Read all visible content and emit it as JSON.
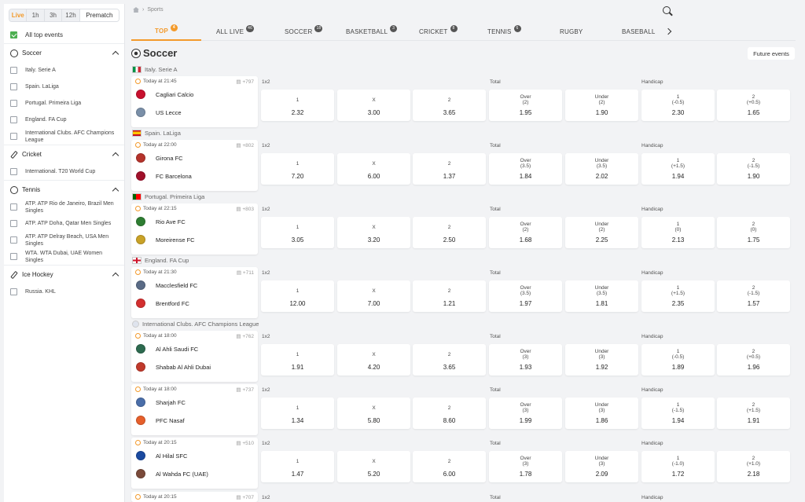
{
  "sidebar": {
    "time_tabs": [
      "Live",
      "1h",
      "3h",
      "12h",
      "Prematch"
    ],
    "all_events": "All top events",
    "sports": [
      {
        "name": "Soccer",
        "icon": "soccer-ball-icon",
        "leagues": [
          "Italy. Serie A",
          "Spain. LaLiga",
          "Portugal. Primeira Liga",
          "England. FA Cup",
          "International Clubs. AFC Champions League"
        ]
      },
      {
        "name": "Cricket",
        "icon": "cricket-bat-icon",
        "leagues": [
          "International. T20 World Cup"
        ]
      },
      {
        "name": "Tennis",
        "icon": "tennis-ball-icon",
        "leagues": [
          "ATP. ATP Rio de Janeiro, Brazil Men Singles",
          "ATP. ATP Doha, Qatar Men Singles",
          "ATP. ATP Delray Beach, USA Men Singles",
          "WTA. WTA Dubai, UAE Women Singles"
        ]
      },
      {
        "name": "Ice Hockey",
        "icon": "hockey-stick-icon",
        "leagues": [
          "Russia. KHL"
        ]
      }
    ]
  },
  "breadcrumb": {
    "current": "Sports"
  },
  "tabs": [
    {
      "label": "TOP",
      "badge": "4"
    },
    {
      "label": "ALL LIVE",
      "badge": "46"
    },
    {
      "label": "SOCCER",
      "badge": "18"
    },
    {
      "label": "BASKETBALL",
      "badge": "3"
    },
    {
      "label": "CRICKET",
      "badge": "8"
    },
    {
      "label": "TENNIS",
      "badge": "6"
    },
    {
      "label": "RUGBY",
      "badge": ""
    },
    {
      "label": "BASEBALL",
      "badge": ""
    }
  ],
  "section": {
    "title": "Soccer",
    "future_button": "Future events"
  },
  "markets": {
    "m1": "1x2",
    "m2": "Total",
    "m3": "Handicap"
  },
  "matches": [
    {
      "league": "Italy. Serie A",
      "time": "Today at 21:45",
      "more": "+797",
      "home": "Cagliari Calcio",
      "away": "US Lecce",
      "odds": [
        [
          "1",
          "",
          "2.32"
        ],
        [
          "X",
          "",
          "3.00"
        ],
        [
          "2",
          "",
          "3.65"
        ],
        [
          "Over",
          "(2)",
          "1.95"
        ],
        [
          "Under",
          "(2)",
          "1.90"
        ],
        [
          "1",
          "(-0.5)",
          "2.30"
        ],
        [
          "2",
          "(+0.5)",
          "1.65"
        ]
      ]
    },
    {
      "league": "Spain. LaLiga",
      "time": "Today at 22:00",
      "more": "+802",
      "home": "Girona FC",
      "away": "FC Barcelona",
      "odds": [
        [
          "1",
          "",
          "7.20"
        ],
        [
          "X",
          "",
          "6.00"
        ],
        [
          "2",
          "",
          "1.37"
        ],
        [
          "Over",
          "(3.5)",
          "1.84"
        ],
        [
          "Under",
          "(3.5)",
          "2.02"
        ],
        [
          "1",
          "(+1.5)",
          "1.94"
        ],
        [
          "2",
          "(-1.5)",
          "1.90"
        ]
      ]
    },
    {
      "league": "Portugal. Primeira Liga",
      "time": "Today at 22:15",
      "more": "+803",
      "home": "Rio Ave FC",
      "away": "Moreirense FC",
      "odds": [
        [
          "1",
          "",
          "3.05"
        ],
        [
          "X",
          "",
          "3.20"
        ],
        [
          "2",
          "",
          "2.50"
        ],
        [
          "Over",
          "(2)",
          "1.68"
        ],
        [
          "Under",
          "(2)",
          "2.25"
        ],
        [
          "1",
          "(0)",
          "2.13"
        ],
        [
          "2",
          "(0)",
          "1.75"
        ]
      ]
    },
    {
      "league": "England. FA Cup",
      "time": "Today at 21:30",
      "more": "+711",
      "home": "Macclesfield FC",
      "away": "Brentford FC",
      "odds": [
        [
          "1",
          "",
          "12.00"
        ],
        [
          "X",
          "",
          "7.00"
        ],
        [
          "2",
          "",
          "1.21"
        ],
        [
          "Over",
          "(3.5)",
          "1.97"
        ],
        [
          "Under",
          "(3.5)",
          "1.81"
        ],
        [
          "1",
          "(+1.5)",
          "2.35"
        ],
        [
          "2",
          "(-1.5)",
          "1.57"
        ]
      ]
    },
    {
      "league": "International Clubs. AFC Champions League",
      "time": "Today at 18:00",
      "more": "+762",
      "home": "Al Ahli Saudi FC",
      "away": "Shabab Al Ahli Dubai",
      "odds": [
        [
          "1",
          "",
          "1.91"
        ],
        [
          "X",
          "",
          "4.20"
        ],
        [
          "2",
          "",
          "3.65"
        ],
        [
          "Over",
          "(3)",
          "1.93"
        ],
        [
          "Under",
          "(3)",
          "1.92"
        ],
        [
          "1",
          "(-0.5)",
          "1.89"
        ],
        [
          "2",
          "(+0.5)",
          "1.96"
        ]
      ]
    },
    {
      "league": "",
      "time": "Today at 18:00",
      "more": "+737",
      "home": "Sharjah FC",
      "away": "PFC Nasaf",
      "odds": [
        [
          "1",
          "",
          "1.34"
        ],
        [
          "X",
          "",
          "5.80"
        ],
        [
          "2",
          "",
          "8.60"
        ],
        [
          "Over",
          "(3)",
          "1.99"
        ],
        [
          "Under",
          "(3)",
          "1.86"
        ],
        [
          "1",
          "(-1.5)",
          "1.94"
        ],
        [
          "2",
          "(+1.5)",
          "1.91"
        ]
      ]
    },
    {
      "league": "",
      "time": "Today at 20:15",
      "more": "+510",
      "home": "Al Hilal SFC",
      "away": "Al Wahda FC (UAE)",
      "odds": [
        [
          "1",
          "",
          "1.47"
        ],
        [
          "X",
          "",
          "5.20"
        ],
        [
          "2",
          "",
          "6.00"
        ],
        [
          "Over",
          "(3)",
          "1.78"
        ],
        [
          "Under",
          "(3)",
          "2.09"
        ],
        [
          "1",
          "(-1.0)",
          "1.72"
        ],
        [
          "2",
          "(+1.0)",
          "2.18"
        ]
      ]
    },
    {
      "league": "",
      "time": "Today at 20:15",
      "more": "+707",
      "home": "",
      "away": "",
      "odds": []
    }
  ],
  "colors": {
    "accent": "#f39a2b",
    "check": "#4caf50"
  }
}
